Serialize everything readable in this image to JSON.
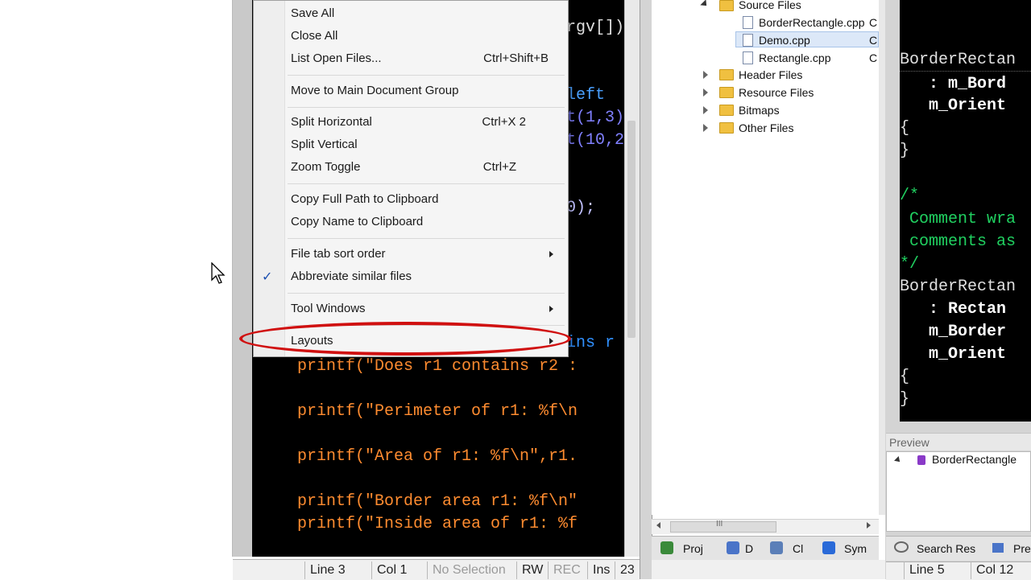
{
  "menu": {
    "items": [
      {
        "label": "Save All",
        "shortcut": ""
      },
      {
        "label": "Close All",
        "shortcut": ""
      },
      {
        "label": "List Open Files...",
        "shortcut": "Ctrl+Shift+B"
      },
      {
        "label": "Move to Main Document Group",
        "shortcut": ""
      },
      {
        "label": "Split Horizontal",
        "shortcut": "Ctrl+X 2"
      },
      {
        "label": "Split Vertical",
        "shortcut": ""
      },
      {
        "label": "Zoom Toggle",
        "shortcut": "Ctrl+Z"
      },
      {
        "label": "Copy Full Path to Clipboard",
        "shortcut": ""
      },
      {
        "label": "Copy Name to Clipboard",
        "shortcut": ""
      },
      {
        "label": "File tab sort order",
        "shortcut": ""
      },
      {
        "label": "Abbreviate similar files",
        "shortcut": ""
      },
      {
        "label": "Tool Windows",
        "shortcut": ""
      },
      {
        "label": "Layouts",
        "shortcut": ""
      }
    ],
    "checkmark": "✓"
  },
  "editor_left": {
    "lines": [
      {
        "text": "rgv[])",
        "color": "#e0e0e0"
      },
      {
        "text": "left",
        "color": "#4aa0ff"
      },
      {
        "text": "t(1,3)",
        "color": "#8080ff"
      },
      {
        "text": "t(10,2",
        "color": "#8080ff"
      },
      {
        "text": "0);",
        "color": "#c0c0ff"
      },
      {
        "text": "ins r",
        "color": "#3090ff"
      },
      {
        "text": "printf(\"Does r1 contains r2 :",
        "color": "#ff8c30"
      },
      {
        "text": "printf(\"Perimeter of r1: %f\\n",
        "color": "#ff8c30"
      },
      {
        "text": "printf(\"Area of r1: %f\\n\",r1.",
        "color": "#ff8c30"
      },
      {
        "text": "printf(\"Border area r1: %f\\n\"",
        "color": "#ff8c30"
      },
      {
        "text": "printf(\"Inside area of r1: %f",
        "color": "#ff8c30"
      }
    ]
  },
  "status_left": {
    "line": "Line 3",
    "col": "Col 1",
    "selection": "No Selection",
    "rw": "RW",
    "rec": "REC",
    "ins": "Ins",
    "num": "23"
  },
  "tree": {
    "source_files": "Source Files",
    "files": [
      "BorderRectangle.cpp",
      "Demo.cpp",
      "Rectangle.cpp"
    ],
    "file_suffix": "C",
    "folders": [
      "Header Files",
      "Resource Files",
      "Bitmaps",
      "Other Files"
    ],
    "scroll_glyph": "III"
  },
  "proj_tabs": [
    "Proj",
    "D",
    "Cl",
    "Sym"
  ],
  "editor_right": {
    "lines": [
      {
        "text": "BorderRectan",
        "color": "#e0e0e0"
      },
      {
        "text": "   : m_Bord",
        "color": "#ffffff"
      },
      {
        "text": "   m_Orient",
        "color": "#ffffff"
      },
      {
        "text": "{",
        "color": "#e0e0e0"
      },
      {
        "text": "}",
        "color": "#e0e0e0"
      },
      {
        "text": "/*",
        "color": "#20d060"
      },
      {
        "text": " Comment wra",
        "color": "#20d060"
      },
      {
        "text": " comments as",
        "color": "#20d060"
      },
      {
        "text": "*/",
        "color": "#20d060"
      },
      {
        "text": "BorderRectan",
        "color": "#e0e0e0"
      },
      {
        "text": "   : Rectan",
        "color": "#ffffff"
      },
      {
        "text": "   m_Border",
        "color": "#ffffff"
      },
      {
        "text": "   m_Orient",
        "color": "#ffffff"
      },
      {
        "text": "{",
        "color": "#e0e0e0"
      },
      {
        "text": "}",
        "color": "#e0e0e0"
      }
    ]
  },
  "preview": {
    "title": "Preview",
    "item": "BorderRectangle"
  },
  "right_tabs": [
    "Search Res",
    "Pre"
  ],
  "status_right": {
    "line": "Line 5",
    "col": "Col 12"
  }
}
